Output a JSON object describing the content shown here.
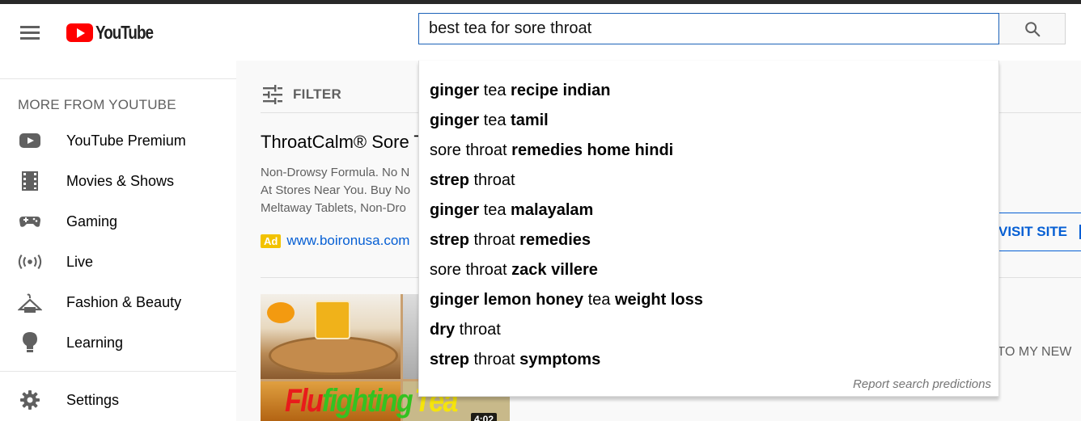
{
  "header": {
    "menu_icon": "hamburger-icon",
    "logo_text": "YouTube",
    "search": {
      "value": "best tea for sore throat",
      "placeholder": "Search"
    },
    "search_icon": "search-icon"
  },
  "sidebar": {
    "section_title": "MORE FROM YOUTUBE",
    "items": [
      {
        "label": "YouTube Premium",
        "icon": "youtube-premium-icon"
      },
      {
        "label": "Movies & Shows",
        "icon": "film-icon"
      },
      {
        "label": "Gaming",
        "icon": "gamepad-icon"
      },
      {
        "label": "Live",
        "icon": "live-broadcast-icon"
      },
      {
        "label": "Fashion & Beauty",
        "icon": "hanger-icon"
      },
      {
        "label": "Learning",
        "icon": "lightbulb-icon"
      }
    ],
    "settings": {
      "label": "Settings",
      "icon": "gear-icon"
    }
  },
  "main": {
    "filter_label": "FILTER",
    "ad": {
      "title": "ThroatCalm® Sore T",
      "desc_lines": [
        "Non-Drowsy Formula. No N",
        "At Stores Near You. Buy No",
        "Meltaway Tablets, Non-Dro"
      ],
      "badge": "Ad",
      "url": "www.boironusa.com",
      "visit_label": "VISIT SITE"
    },
    "video": {
      "thumb_text_1": "Flu",
      "thumb_text_2": "fighting",
      "thumb_text_3": "Tea",
      "duration": "4:02"
    },
    "subscribe_clip": "BE TO MY NEW"
  },
  "suggestions": [
    [
      [
        "ginger",
        true
      ],
      [
        " tea ",
        false
      ],
      [
        "recipe indian",
        true
      ]
    ],
    [
      [
        "ginger",
        true
      ],
      [
        " tea ",
        false
      ],
      [
        "tamil",
        true
      ]
    ],
    [
      [
        "sore throat ",
        false
      ],
      [
        "remedies home hindi",
        true
      ]
    ],
    [
      [
        "strep",
        true
      ],
      [
        " throat",
        false
      ]
    ],
    [
      [
        "ginger",
        true
      ],
      [
        " tea ",
        false
      ],
      [
        "malayalam",
        true
      ]
    ],
    [
      [
        "strep",
        true
      ],
      [
        " throat ",
        false
      ],
      [
        "remedies",
        true
      ]
    ],
    [
      [
        "sore throat ",
        false
      ],
      [
        "zack villere",
        true
      ]
    ],
    [
      [
        "ginger lemon honey",
        true
      ],
      [
        " tea ",
        false
      ],
      [
        "weight loss",
        true
      ]
    ],
    [
      [
        "dry",
        true
      ],
      [
        " throat",
        false
      ]
    ],
    [
      [
        "strep",
        true
      ],
      [
        " throat ",
        false
      ],
      [
        "symptoms",
        true
      ]
    ]
  ],
  "report_link": "Report search predictions",
  "colors": {
    "brand_red": "#ff0000",
    "link_blue": "#065fd4",
    "ad_yellow": "#f2c200",
    "focus_blue": "#1c62b9"
  }
}
